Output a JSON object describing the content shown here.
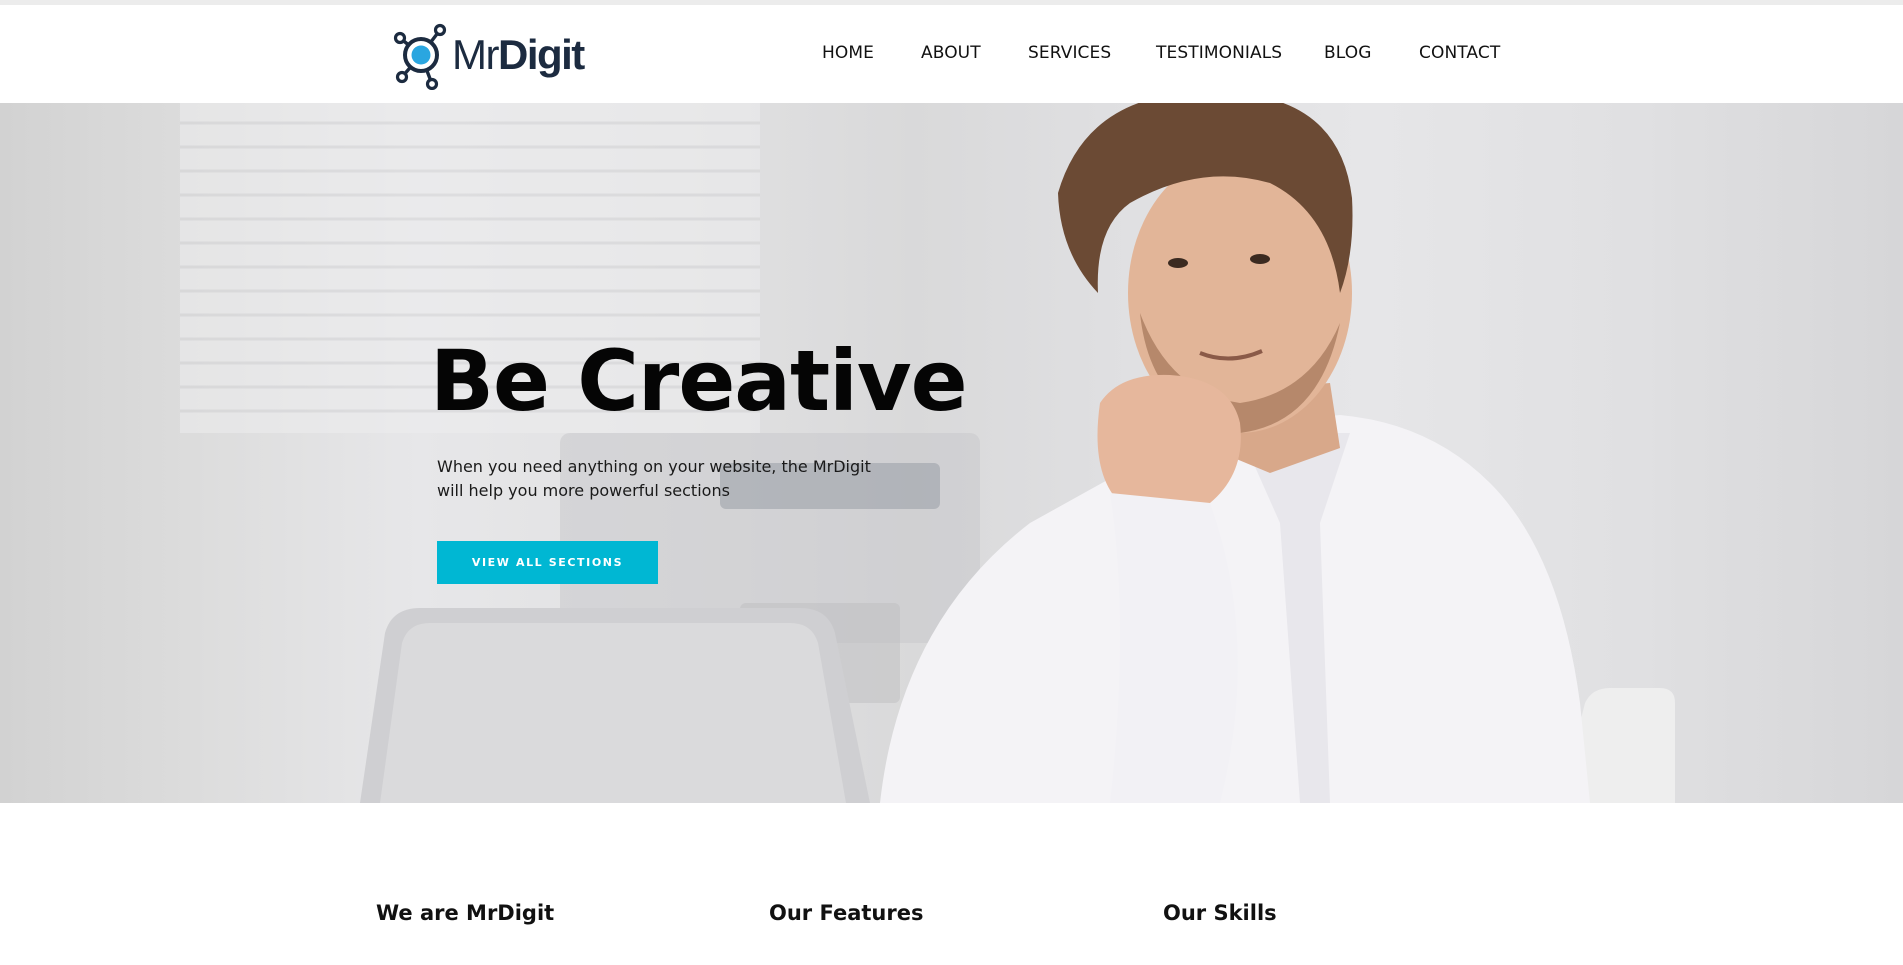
{
  "brand": {
    "name_light": "Mr",
    "name_bold": "Digit",
    "colors": {
      "navy": "#1c2b40",
      "accent": "#00b7d3",
      "logo_dot": "#2aa6e0"
    },
    "logo_icon": "network-circle-icon"
  },
  "nav": {
    "items": [
      {
        "label": "HOME"
      },
      {
        "label": "ABOUT"
      },
      {
        "label": "SERVICES"
      },
      {
        "label": "TESTIMONIALS"
      },
      {
        "label": "BLOG"
      },
      {
        "label": "CONTACT"
      }
    ]
  },
  "hero": {
    "title": "Be Creative",
    "subtitle": "When you need anything on your website, the MrDigit will help you more powerful sections",
    "button_label": "VIEW ALL SECTIONS",
    "background_image": "man-in-office-photo"
  },
  "sections": [
    {
      "heading": "We are MrDigit"
    },
    {
      "heading": "Our Features"
    },
    {
      "heading": "Our Skills"
    }
  ]
}
